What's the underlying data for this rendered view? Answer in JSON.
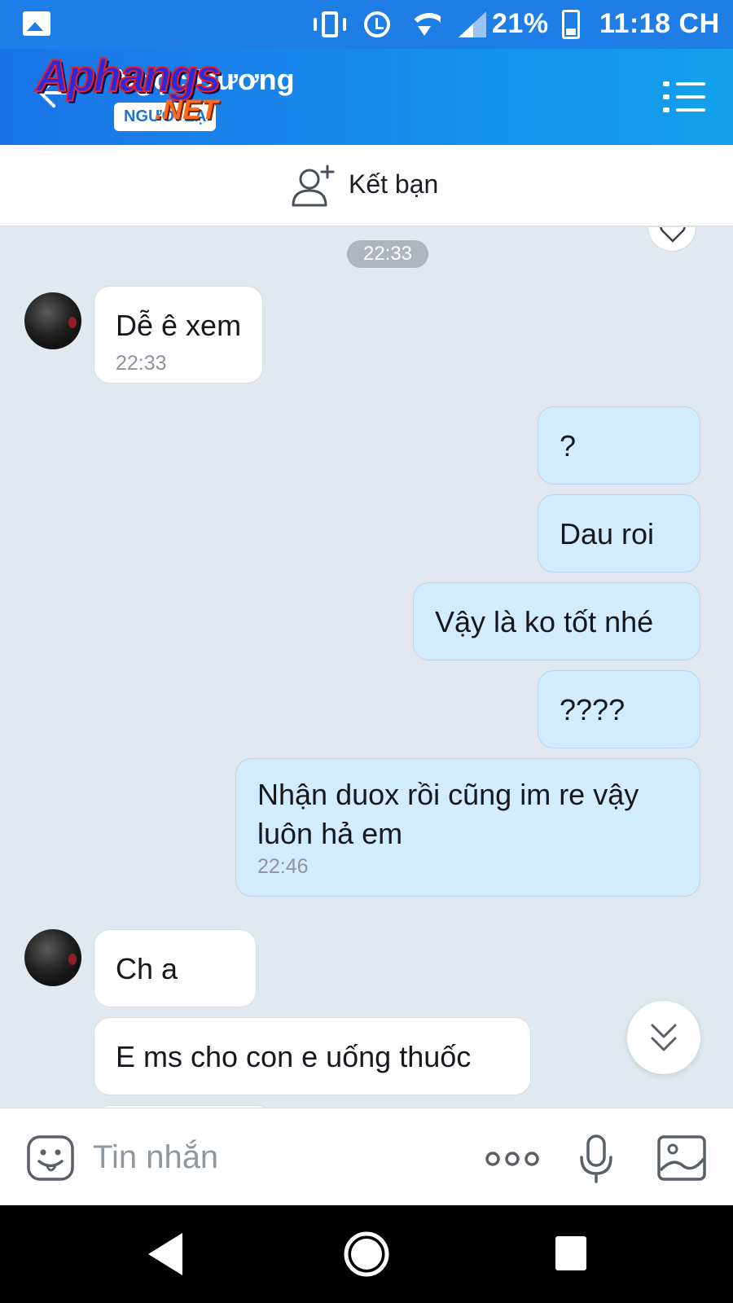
{
  "status_bar": {
    "battery": "21%",
    "time": "11:18 CH",
    "icons": [
      "gallery-icon",
      "vibrate-icon",
      "alarm-icon",
      "wifi-icon",
      "signal-icon",
      "battery-icon"
    ]
  },
  "header": {
    "contact_name": "Ngọc Dương",
    "badge": "NGƯỜI LẠ",
    "watermark": "Aphangs",
    "watermark_suffix": ".NET",
    "colors": {
      "gradient_start": "#1a74e8",
      "gradient_end": "#14a0ec"
    }
  },
  "friend_bar": {
    "label": "Kết bạn"
  },
  "chat": {
    "date_chip": "22:33",
    "messages": [
      {
        "side": "in",
        "text": "Dễ ê xem",
        "time": "22:33"
      },
      {
        "side": "out",
        "text": "?"
      },
      {
        "side": "out",
        "text": "Dau roi"
      },
      {
        "side": "out",
        "text": "Vậy là ko tốt nhé"
      },
      {
        "side": "out",
        "text": "????"
      },
      {
        "side": "out",
        "text": "Nhận duox rồi cũng im re vậy\nluôn hả em",
        "time": "22:46"
      },
      {
        "side": "in",
        "text": "Ch a"
      },
      {
        "side": "in",
        "text": "E ms cho con e uống thuốc"
      }
    ],
    "colors": {
      "background": "#e2e8ef",
      "incoming": "#ffffff",
      "outgoing": "#d4ecff"
    }
  },
  "input_bar": {
    "placeholder": "Tin nhắn"
  }
}
